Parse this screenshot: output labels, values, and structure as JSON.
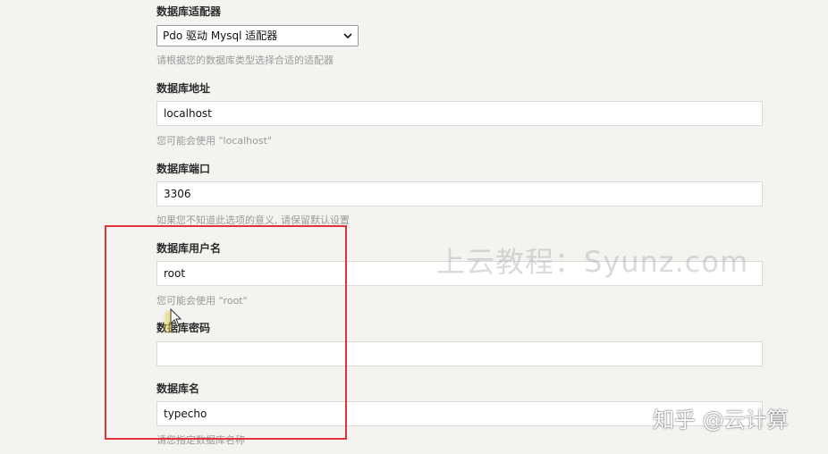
{
  "adapter": {
    "label": "数据库适配器",
    "selected": "Pdo 驱动 Mysql 适配器",
    "hint": "请根据您的数据库类型选择合适的适配器"
  },
  "host": {
    "label": "数据库地址",
    "value": "localhost",
    "hint": "您可能会使用 \"localhost\""
  },
  "port": {
    "label": "数据库端口",
    "value": "3306",
    "hint": "如果您不知道此选项的意义, 请保留默认设置"
  },
  "user": {
    "label": "数据库用户名",
    "value": "root",
    "hint": "您可能会使用 \"root\""
  },
  "password": {
    "label": "数据库密码",
    "value": ""
  },
  "dbname": {
    "label": "数据库名",
    "value": "typecho",
    "hint": "请您指定数据库名称"
  },
  "watermark": "上云教程：Syunz.com",
  "credit": "知乎 @云计算",
  "colors": {
    "highlight": "#e0323a",
    "background": "#f3f3f0",
    "hint": "#9a9a9a"
  },
  "icons": {
    "select_arrow": "chevron-down-icon",
    "pointer": "mouse-cursor-icon"
  }
}
